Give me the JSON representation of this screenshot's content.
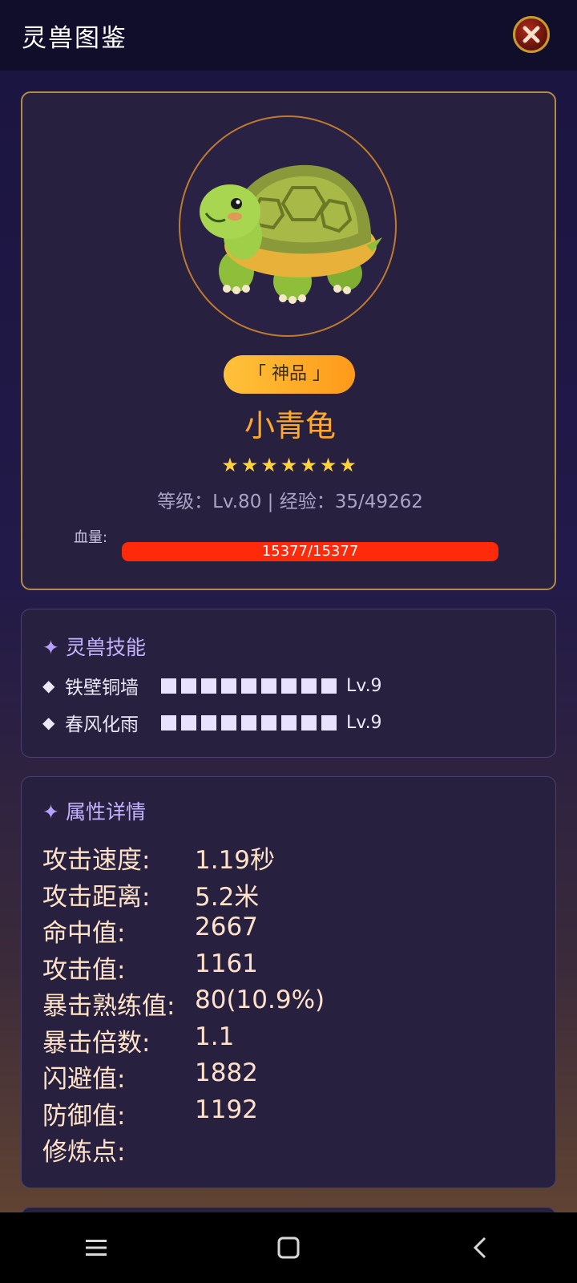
{
  "header": {
    "title": "灵兽图鉴"
  },
  "beast": {
    "rarity": "「 神品 」",
    "name": "小青龟",
    "stars": 7,
    "stars_text": "★★★★★★★",
    "level_line": "等级：Lv.80 | 经验：35/49262",
    "hp_label": "血量:",
    "hp_text": "15377/15377",
    "hp_fraction": 1.0
  },
  "skills": {
    "title": "灵兽技能",
    "items": [
      {
        "name": "铁壁铜墙",
        "level_text": "Lv.9",
        "level": 9
      },
      {
        "name": "春风化雨",
        "level_text": "Lv.9",
        "level": 9
      }
    ]
  },
  "attributes": {
    "title": "属性详情",
    "rows": [
      {
        "label": "攻击速度:",
        "value": "1.19秒"
      },
      {
        "label": "攻击距离:",
        "value": "5.2米"
      },
      {
        "label": "命中值:",
        "value": "2667"
      },
      {
        "label": "攻击值:",
        "value": "1161"
      },
      {
        "label": "暴击熟练值:",
        "value": "80(10.9%)"
      },
      {
        "label": "暴击倍数:",
        "value": "1.1"
      },
      {
        "label": "闪避值:",
        "value": "1882"
      },
      {
        "label": "防御值:",
        "value": "1192"
      },
      {
        "label": "修炼点:",
        "value": ""
      }
    ]
  },
  "colors": {
    "accent_orange": "#ffa82a",
    "hp_red": "#ff2a0a",
    "star_yellow": "#ffd23a",
    "section_purple": "#c4b4ff"
  },
  "icons": {
    "close": "close-x-icon",
    "spark": "sparkle-icon",
    "diamond": "diamond-bullet-icon",
    "nav_menu": "menu-icon",
    "nav_home": "home-square-icon",
    "nav_back": "back-chevron-icon"
  }
}
